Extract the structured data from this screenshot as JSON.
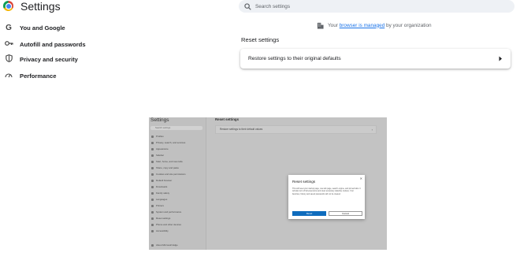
{
  "header": {
    "title": "Settings"
  },
  "sidebar": {
    "items": [
      {
        "label": "You and Google",
        "icon": "google-g-icon"
      },
      {
        "label": "Autofill and passwords",
        "icon": "key-icon"
      },
      {
        "label": "Privacy and security",
        "icon": "shield-icon"
      },
      {
        "label": "Performance",
        "icon": "speedometer-icon"
      }
    ]
  },
  "search": {
    "placeholder": "Search settings"
  },
  "managed": {
    "prefix": "Your",
    "link": "browser is managed",
    "suffix": "by your organization"
  },
  "main": {
    "section_title": "Reset settings",
    "reset_row_label": "Restore settings to their original defaults"
  },
  "embedded": {
    "title": "Settings",
    "search_placeholder": "Search settings",
    "sidebar_items": [
      "Profiles",
      "Privacy, search, and services",
      "Appearance",
      "Sidebar",
      "Start, home, and new tabs",
      "Share, copy and paste",
      "Cookies and site permissions",
      "Default browser",
      "Downloads",
      "Family safety",
      "Languages",
      "Printers",
      "System and performance",
      "Reset settings",
      "Phone and other devices",
      "Accessibility",
      "About Microsoft Edge"
    ],
    "section_title": "Reset settings",
    "reset_row_label": "Restore settings to their default values",
    "dialog": {
      "title": "Reset settings",
      "body": "This will reset your startup page, new tab page, search engine, and pinned tabs. It will also turn off all extensions and clear temporary data like cookies. Your favorites, history and saved passwords will not be cleared.",
      "reset_label": "Reset",
      "cancel_label": "Cancel"
    }
  },
  "colors": {
    "accent": "#1a73e8",
    "edge_blue": "#0f6cbd",
    "search_bg": "#eef1f5"
  }
}
